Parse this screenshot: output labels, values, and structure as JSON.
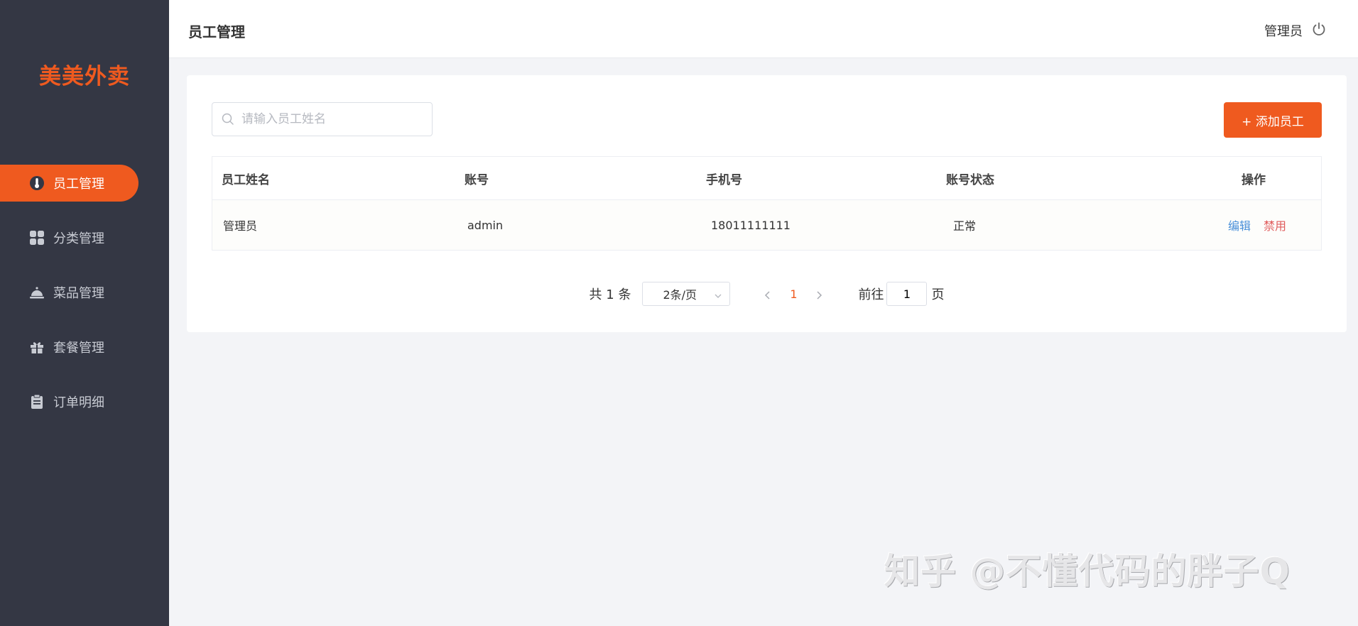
{
  "brand": {
    "name": "美美外卖",
    "accent_color": "#ef5a1f"
  },
  "sidebar": {
    "items": [
      {
        "label": "员工管理",
        "icon": "thermometer-icon",
        "active": true
      },
      {
        "label": "分类管理",
        "icon": "grid-icon",
        "active": false
      },
      {
        "label": "菜品管理",
        "icon": "cloche-icon",
        "active": false
      },
      {
        "label": "套餐管理",
        "icon": "gift-icon",
        "active": false
      },
      {
        "label": "订单明细",
        "icon": "clipboard-icon",
        "active": false
      }
    ]
  },
  "header": {
    "title": "员工管理",
    "user": "管理员",
    "logout_icon": "power-icon"
  },
  "toolbar": {
    "search_placeholder": "请输入员工姓名",
    "search_value": "",
    "add_label": "+ 添加员工"
  },
  "table": {
    "columns": [
      "员工姓名",
      "账号",
      "手机号",
      "账号状态",
      "操作"
    ],
    "rows": [
      {
        "name": "管理员",
        "account": "admin",
        "phone": "18011111111",
        "status": "正常",
        "actions": [
          "编辑",
          "禁用"
        ]
      }
    ]
  },
  "pagination": {
    "total": "共 1 条",
    "page_size": "2条/页",
    "current_page": "1",
    "goto_label": "前往",
    "goto_value": "1",
    "page_unit": "页"
  },
  "watermark": "知乎 @不懂代码的胖子Q"
}
